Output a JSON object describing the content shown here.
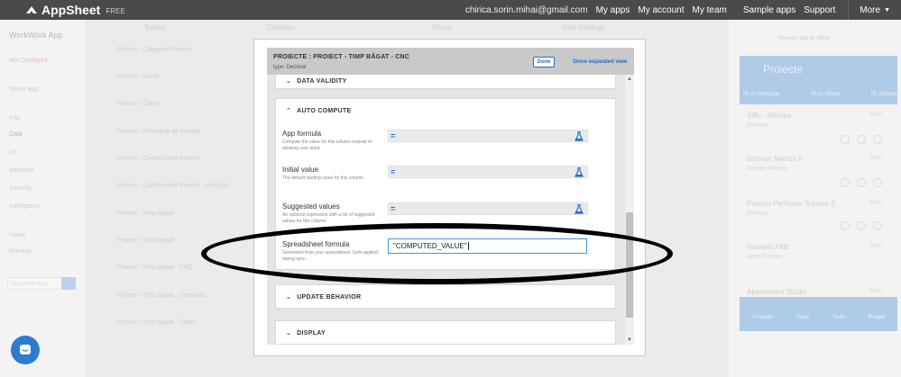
{
  "topbar": {
    "brand": "AppSheet",
    "badge": "FREE",
    "email": "chirica.sorin.mihai@gmail.com",
    "links": [
      "My apps",
      "My account",
      "My team",
      "Sample apps",
      "Support"
    ],
    "more": "More"
  },
  "background": {
    "app_name": "WorkWork App",
    "nav": [
      "Not Deployed",
      "Share app",
      "Info",
      "Data",
      "UX",
      "Behavior",
      "Security",
      "Intelligence",
      "Views",
      "Manage"
    ],
    "search_placeholder": "Search for help",
    "tabs": [
      "Tables",
      "Columns",
      "Slices",
      "User Settings"
    ],
    "rows": [
      "Proiect - Categorie Proiect",
      "Proiect - Nume",
      "Proiect - Client",
      "Proiect - Persoană de contact",
      "Proiect - Coordonator Proiect",
      "Proiect - Coordonator Proiect - Inlocuitor",
      "Proiect - Timp bagat",
      "Proiect - Timp bagat",
      "Proiect - Timp bagat - CNC",
      "Proiect - Timp bagat - Specialist",
      "Proiect - Timp bagat - Sudor"
    ],
    "preview_title": "Proiecte",
    "preview_link": "Preview app as Mihai",
    "preview_tabs": [
      "PL in Productie",
      "PL in Oferta",
      "PL Sortate"
    ],
    "preview_items": [
      {
        "title": "Xiffu - Mihnea",
        "sub": "Mihnea",
        "tag": "Stmi"
      },
      {
        "title": "Dobrian Manda II",
        "sub": "Dorian Manda",
        "tag": "Stmi"
      },
      {
        "title": "Pascuri Perforate Sunrise 2",
        "sub": "Mihnea",
        "tag": "Stmi"
      },
      {
        "title": "Instalatii Fittit",
        "sub": "Aline Rasoiu",
        "tag": "Stmi"
      },
      {
        "title": "Apartament Studio",
        "sub": "",
        "tag": "Stmi"
      }
    ],
    "preview_footer": [
      "Proiecte",
      "Tasks",
      "Tests",
      "Budget"
    ]
  },
  "modal": {
    "title": "PROIECTE : PROIECT - TIMP BĂGAT - CNC",
    "type_label": "type: Decimal",
    "done_label": "Done",
    "expanded_link": "Show expanded view",
    "sections": {
      "data_validity": "DATA VALIDITY",
      "auto_compute": "AUTO COMPUTE",
      "update_behavior": "UPDATE BEHAVIOR",
      "display": "DISPLAY"
    },
    "fields": {
      "app_formula": {
        "label": "App formula",
        "desc": "Compute the value for this column instead of allowing user input."
      },
      "initial_value": {
        "label": "Initial value",
        "desc": "The default starting value for this column."
      },
      "suggested_values": {
        "label": "Suggested values",
        "desc": "An optional expression with a list of suggested values for this column."
      },
      "spreadsheet_formula": {
        "label": "Spreadsheet formula",
        "desc": "Generated from your spreadsheet. Gets applied during sync.",
        "value": "\"COMPUTED_VALUE\""
      }
    }
  },
  "colors": {
    "accent": "#1f6fd1",
    "topbar": "#4a4a4a",
    "chat": "#2e7bd2"
  },
  "icons": [
    "appsheet-logo-icon",
    "equals-icon",
    "flask-icon",
    "chevron-down-icon",
    "chevron-up-icon",
    "chat-icon",
    "caret-down-icon"
  ]
}
